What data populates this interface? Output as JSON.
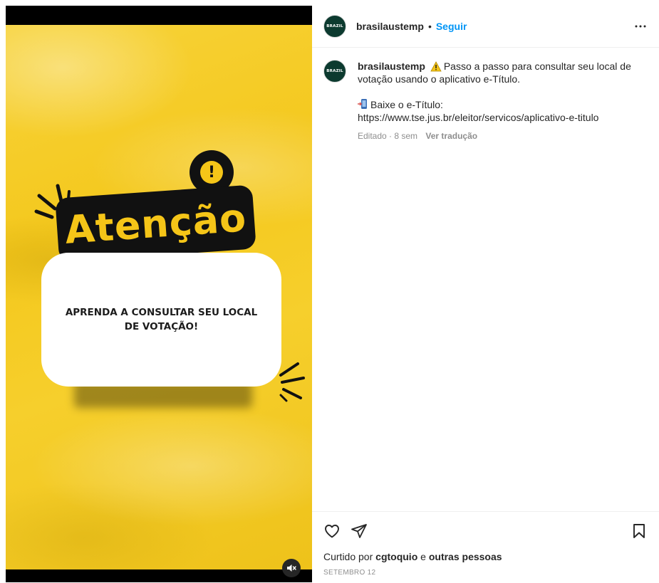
{
  "media": {
    "headline": "Atenção",
    "card_text": "APRENDA A CONSULTAR SEU LOCAL DE VOTAÇÃO!",
    "alert_symbol": "!",
    "mute_icon": "speaker-muted-icon",
    "colors": {
      "background": "#f4c81d",
      "tag": "#111111",
      "accent": "#f5c518"
    }
  },
  "header": {
    "username": "brasilaustemp",
    "separator": "•",
    "follow_label": "Seguir",
    "more_icon": "ellipsis-icon",
    "avatar_text": "BRAZIL"
  },
  "caption": {
    "username": "brasilaustemp",
    "line1": "Passo a passo para consultar seu local de votação usando o aplicativo e-Título.",
    "line2": "Baixe o e-Título:",
    "url": "https://www.tse.jus.br/eleitor/servicos/aplicativo-e-titulo",
    "edited": "Editado · 8 sem",
    "translate": "Ver tradução"
  },
  "actions": {
    "like_icon": "heart-icon",
    "share_icon": "paper-plane-icon",
    "save_icon": "bookmark-icon"
  },
  "likes": {
    "prefix": "Curtido por",
    "user": "cgtoquio",
    "connector": "e",
    "others": "outras pessoas"
  },
  "date": "SETEMBRO 12",
  "colors": {
    "link": "#0095f6",
    "muted": "#8e8e8e",
    "text": "#262626"
  }
}
